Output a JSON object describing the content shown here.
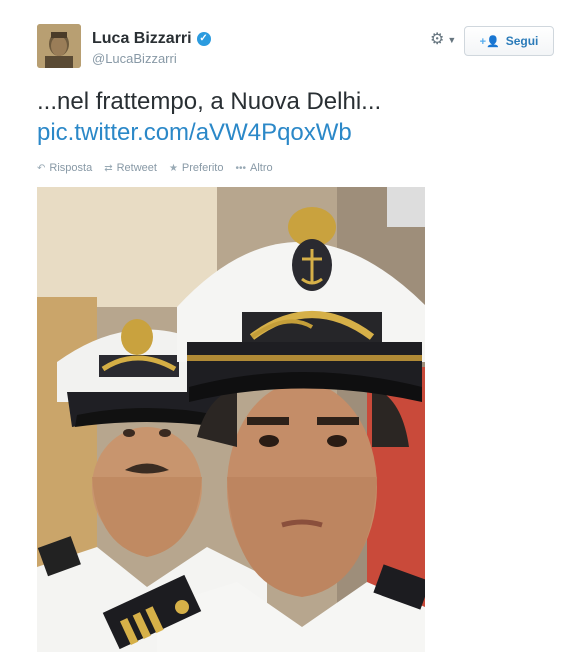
{
  "user": {
    "name": "Luca Bizzarri",
    "handle": "@LucaBizzarri",
    "verified": true
  },
  "header": {
    "follow_label": "Segui",
    "gear_icon": "gear-icon"
  },
  "tweet": {
    "text": "...nel frattempo, a Nuova Delhi...",
    "link": "pic.twitter.com/aVW4PqoxWb"
  },
  "actions": [
    {
      "label": "Risposta",
      "icon": "reply-icon"
    },
    {
      "label": "Retweet",
      "icon": "retweet-icon"
    },
    {
      "label": "Preferito",
      "icon": "star-icon"
    },
    {
      "label": "Altro",
      "icon": "more-icon"
    }
  ],
  "colors": {
    "link": "#2b88c8",
    "verified": "#2b9bdf",
    "muted": "#8899a6"
  }
}
